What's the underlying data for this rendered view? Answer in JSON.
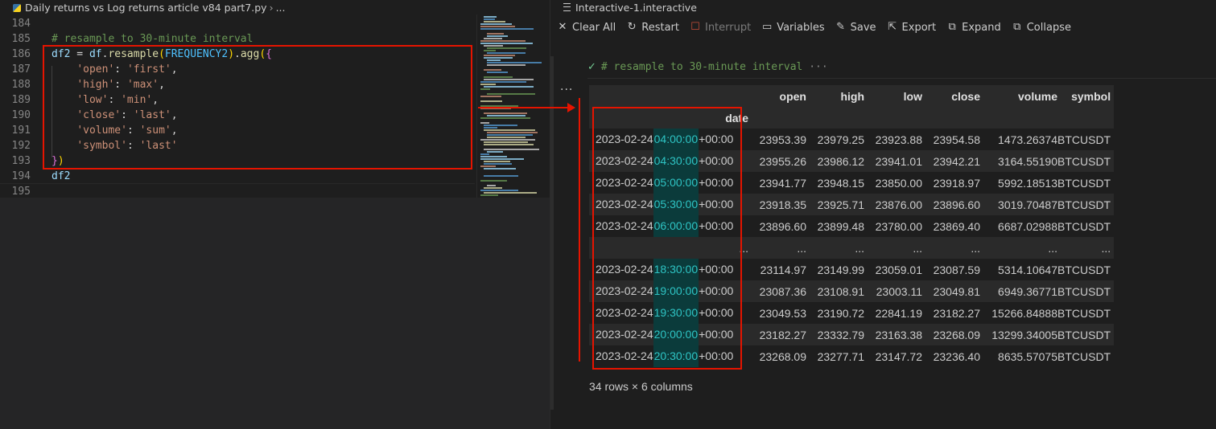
{
  "editor": {
    "breadcrumb": {
      "file": "Daily returns vs Log returns article v84 part7.py",
      "more": "..."
    },
    "lines": [
      {
        "num": "184",
        "tokens": []
      },
      {
        "num": "185",
        "tokens": [
          {
            "c": "com",
            "t": "# resample to 30-minute interval"
          }
        ]
      },
      {
        "num": "186",
        "tokens": [
          {
            "c": "var",
            "t": "df2"
          },
          {
            "c": "pl",
            "t": " = "
          },
          {
            "c": "var",
            "t": "df"
          },
          {
            "c": "pl",
            "t": "."
          },
          {
            "c": "fn",
            "t": "resample"
          },
          {
            "c": "br1",
            "t": "("
          },
          {
            "c": "const",
            "t": "FREQUENCY2"
          },
          {
            "c": "br1",
            "t": ")"
          },
          {
            "c": "pl",
            "t": "."
          },
          {
            "c": "fn",
            "t": "agg"
          },
          {
            "c": "br1",
            "t": "("
          },
          {
            "c": "br2",
            "t": "{"
          }
        ]
      },
      {
        "num": "187",
        "tokens": [
          {
            "c": "pl",
            "t": "    "
          },
          {
            "c": "str",
            "t": "'open'"
          },
          {
            "c": "pl",
            "t": ": "
          },
          {
            "c": "str",
            "t": "'first'"
          },
          {
            "c": "pl",
            "t": ","
          }
        ]
      },
      {
        "num": "188",
        "tokens": [
          {
            "c": "pl",
            "t": "    "
          },
          {
            "c": "str",
            "t": "'high'"
          },
          {
            "c": "pl",
            "t": ": "
          },
          {
            "c": "str",
            "t": "'max'"
          },
          {
            "c": "pl",
            "t": ","
          }
        ]
      },
      {
        "num": "189",
        "tokens": [
          {
            "c": "pl",
            "t": "    "
          },
          {
            "c": "str",
            "t": "'low'"
          },
          {
            "c": "pl",
            "t": ": "
          },
          {
            "c": "str",
            "t": "'min'"
          },
          {
            "c": "pl",
            "t": ","
          }
        ]
      },
      {
        "num": "190",
        "tokens": [
          {
            "c": "pl",
            "t": "    "
          },
          {
            "c": "str",
            "t": "'close'"
          },
          {
            "c": "pl",
            "t": ": "
          },
          {
            "c": "str",
            "t": "'last'"
          },
          {
            "c": "pl",
            "t": ","
          }
        ]
      },
      {
        "num": "191",
        "tokens": [
          {
            "c": "pl",
            "t": "    "
          },
          {
            "c": "str",
            "t": "'volume'"
          },
          {
            "c": "pl",
            "t": ": "
          },
          {
            "c": "str",
            "t": "'sum'"
          },
          {
            "c": "pl",
            "t": ","
          }
        ]
      },
      {
        "num": "192",
        "tokens": [
          {
            "c": "pl",
            "t": "    "
          },
          {
            "c": "str",
            "t": "'symbol'"
          },
          {
            "c": "pl",
            "t": ": "
          },
          {
            "c": "str",
            "t": "'last'"
          }
        ]
      },
      {
        "num": "193",
        "tokens": [
          {
            "c": "br2",
            "t": "}"
          },
          {
            "c": "br1",
            "t": ")"
          }
        ]
      },
      {
        "num": "194",
        "tokens": [
          {
            "c": "var",
            "t": "df2"
          }
        ]
      },
      {
        "num": "195",
        "tokens": []
      }
    ]
  },
  "interactive": {
    "title": "Interactive-1.interactive",
    "toolbar": [
      {
        "icon": "close-icon",
        "glyph": "✕",
        "label": "Clear All",
        "disabled": false
      },
      {
        "icon": "restart-icon",
        "glyph": "↻",
        "label": "Restart",
        "disabled": false
      },
      {
        "icon": "interrupt-icon",
        "glyph": "☐",
        "label": "Interrupt",
        "disabled": true
      },
      {
        "icon": "variables-icon",
        "glyph": "▭",
        "label": "Variables",
        "disabled": false
      },
      {
        "icon": "save-icon",
        "glyph": "✎",
        "label": "Save",
        "disabled": false
      },
      {
        "icon": "export-icon",
        "glyph": "⇱",
        "label": "Export",
        "disabled": false
      },
      {
        "icon": "expand-icon",
        "glyph": "⧉",
        "label": "Expand",
        "disabled": false
      },
      {
        "icon": "collapse-icon",
        "glyph": "⧉",
        "label": "Collapse",
        "disabled": false
      }
    ],
    "cell": {
      "check": "✓",
      "code": "# resample to 30-minute interval",
      "ellipsis": "···"
    },
    "output_menu": "···",
    "table": {
      "columns": [
        "open",
        "high",
        "low",
        "close",
        "volume",
        "symbol"
      ],
      "index_name": "date",
      "rows": [
        {
          "date": "2023-02-24",
          "time": "04:00:00",
          "tz": "+00:00",
          "values": [
            "23953.39",
            "23979.25",
            "23923.88",
            "23954.58",
            "1473.26374",
            "BTCUSDT"
          ]
        },
        {
          "date": "2023-02-24",
          "time": "04:30:00",
          "tz": "+00:00",
          "values": [
            "23955.26",
            "23986.12",
            "23941.01",
            "23942.21",
            "3164.55190",
            "BTCUSDT"
          ]
        },
        {
          "date": "2023-02-24",
          "time": "05:00:00",
          "tz": "+00:00",
          "values": [
            "23941.77",
            "23948.15",
            "23850.00",
            "23918.97",
            "5992.18513",
            "BTCUSDT"
          ]
        },
        {
          "date": "2023-02-24",
          "time": "05:30:00",
          "tz": "+00:00",
          "values": [
            "23918.35",
            "23925.71",
            "23876.00",
            "23896.60",
            "3019.70487",
            "BTCUSDT"
          ]
        },
        {
          "date": "2023-02-24",
          "time": "06:00:00",
          "tz": "+00:00",
          "values": [
            "23896.60",
            "23899.48",
            "23780.00",
            "23869.40",
            "6687.02988",
            "BTCUSDT"
          ]
        },
        {
          "date": "",
          "time": "",
          "tz": "...",
          "values": [
            "...",
            "...",
            "...",
            "...",
            "...",
            "..."
          ]
        },
        {
          "date": "2023-02-24",
          "time": "18:30:00",
          "tz": "+00:00",
          "values": [
            "23114.97",
            "23149.99",
            "23059.01",
            "23087.59",
            "5314.10647",
            "BTCUSDT"
          ]
        },
        {
          "date": "2023-02-24",
          "time": "19:00:00",
          "tz": "+00:00",
          "values": [
            "23087.36",
            "23108.91",
            "23003.11",
            "23049.81",
            "6949.36771",
            "BTCUSDT"
          ]
        },
        {
          "date": "2023-02-24",
          "time": "19:30:00",
          "tz": "+00:00",
          "values": [
            "23049.53",
            "23190.72",
            "22841.19",
            "23182.27",
            "15266.84888",
            "BTCUSDT"
          ]
        },
        {
          "date": "2023-02-24",
          "time": "20:00:00",
          "tz": "+00:00",
          "values": [
            "23182.27",
            "23332.79",
            "23163.38",
            "23268.09",
            "13299.34005",
            "BTCUSDT"
          ]
        },
        {
          "date": "2023-02-24",
          "time": "20:30:00",
          "tz": "+00:00",
          "values": [
            "23268.09",
            "23277.71",
            "23147.72",
            "23236.40",
            "8635.57075",
            "BTCUSDT"
          ]
        }
      ],
      "caption": "34 rows × 6 columns"
    }
  },
  "colors": {
    "annotation_red": "#e51400",
    "time_highlight": "#2ec4c4",
    "success_check": "#73c991"
  }
}
